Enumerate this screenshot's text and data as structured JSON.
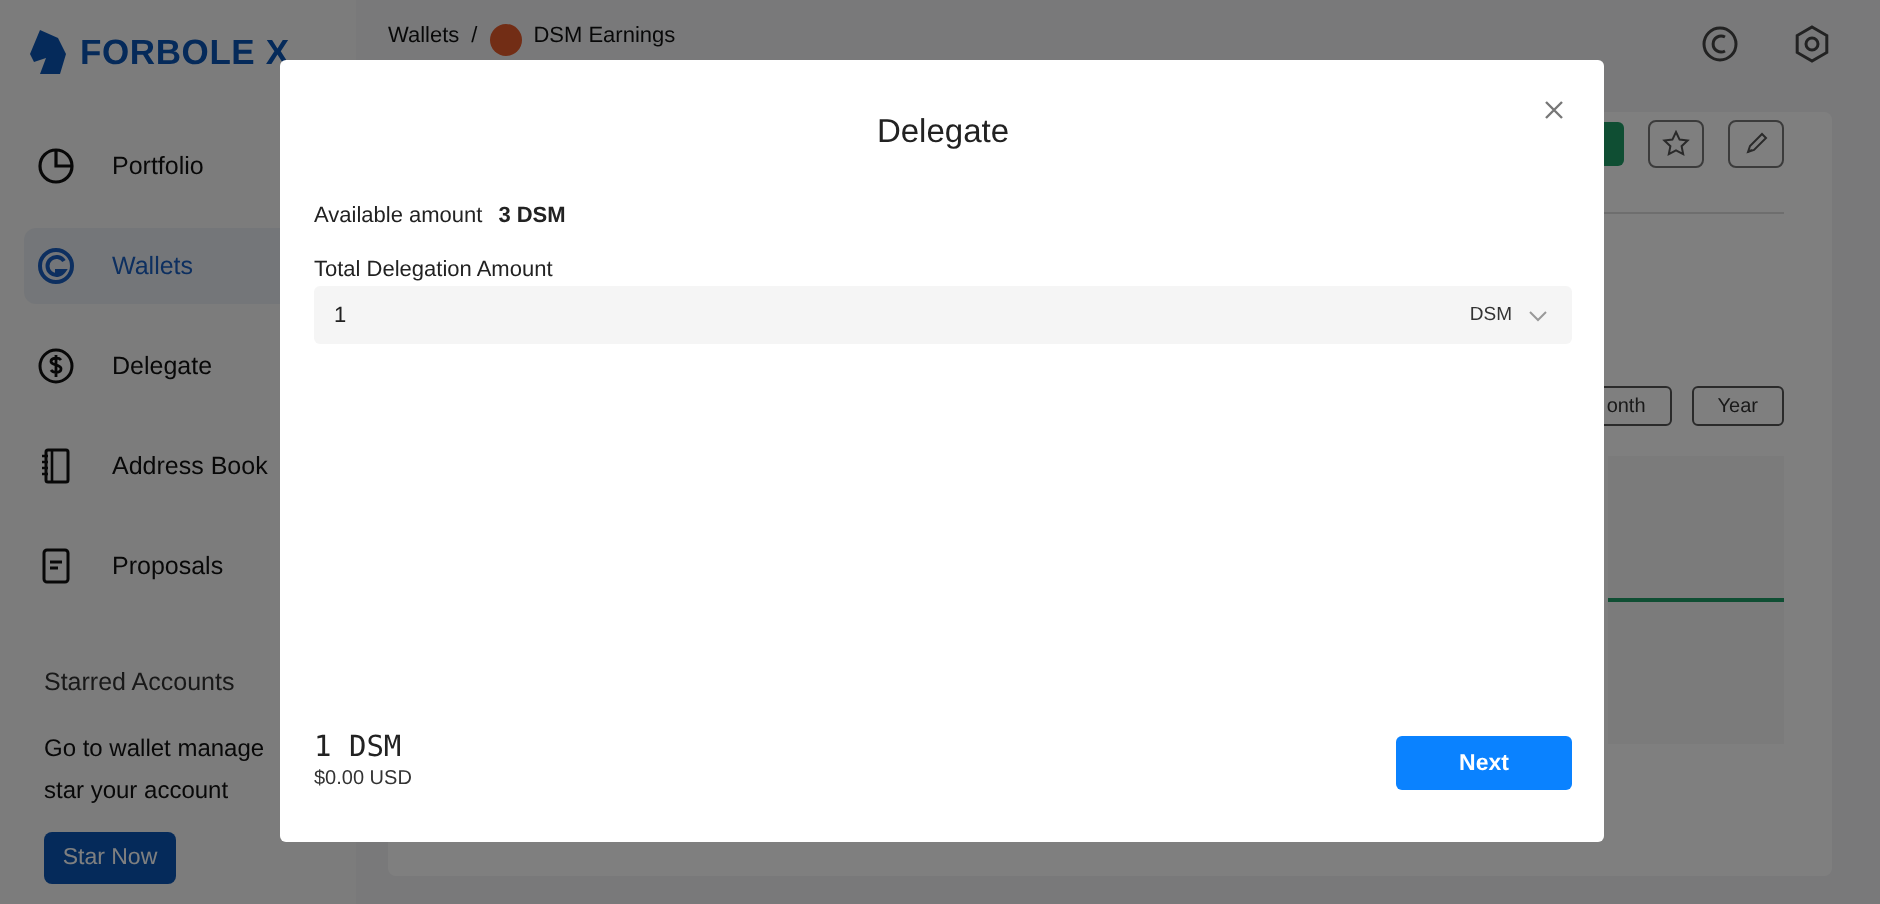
{
  "logo": {
    "text": "FORBOLE X"
  },
  "sidebar": {
    "items": [
      {
        "label": "Portfolio",
        "selected": false
      },
      {
        "label": "Wallets",
        "selected": true
      },
      {
        "label": "Delegate",
        "selected": false
      },
      {
        "label": "Address Book",
        "selected": false
      },
      {
        "label": "Proposals",
        "selected": false
      }
    ]
  },
  "starred": {
    "title": "Starred Accounts",
    "lines": [
      "Go to wallet manage",
      "star your account"
    ],
    "button": "Star Now"
  },
  "breadcrumb": {
    "parent": "Wallets",
    "separator": "/",
    "current": "DSM Earnings"
  },
  "period_buttons": [
    "onth",
    "Year"
  ],
  "modal": {
    "title": "Delegate",
    "available_label": "Available amount",
    "available_value": "3 DSM",
    "amount_label": "Total Delegation Amount",
    "amount_value": "1",
    "denom": "DSM",
    "total": "1 DSM",
    "total_usd": "$0.00 USD",
    "next": "Next"
  }
}
